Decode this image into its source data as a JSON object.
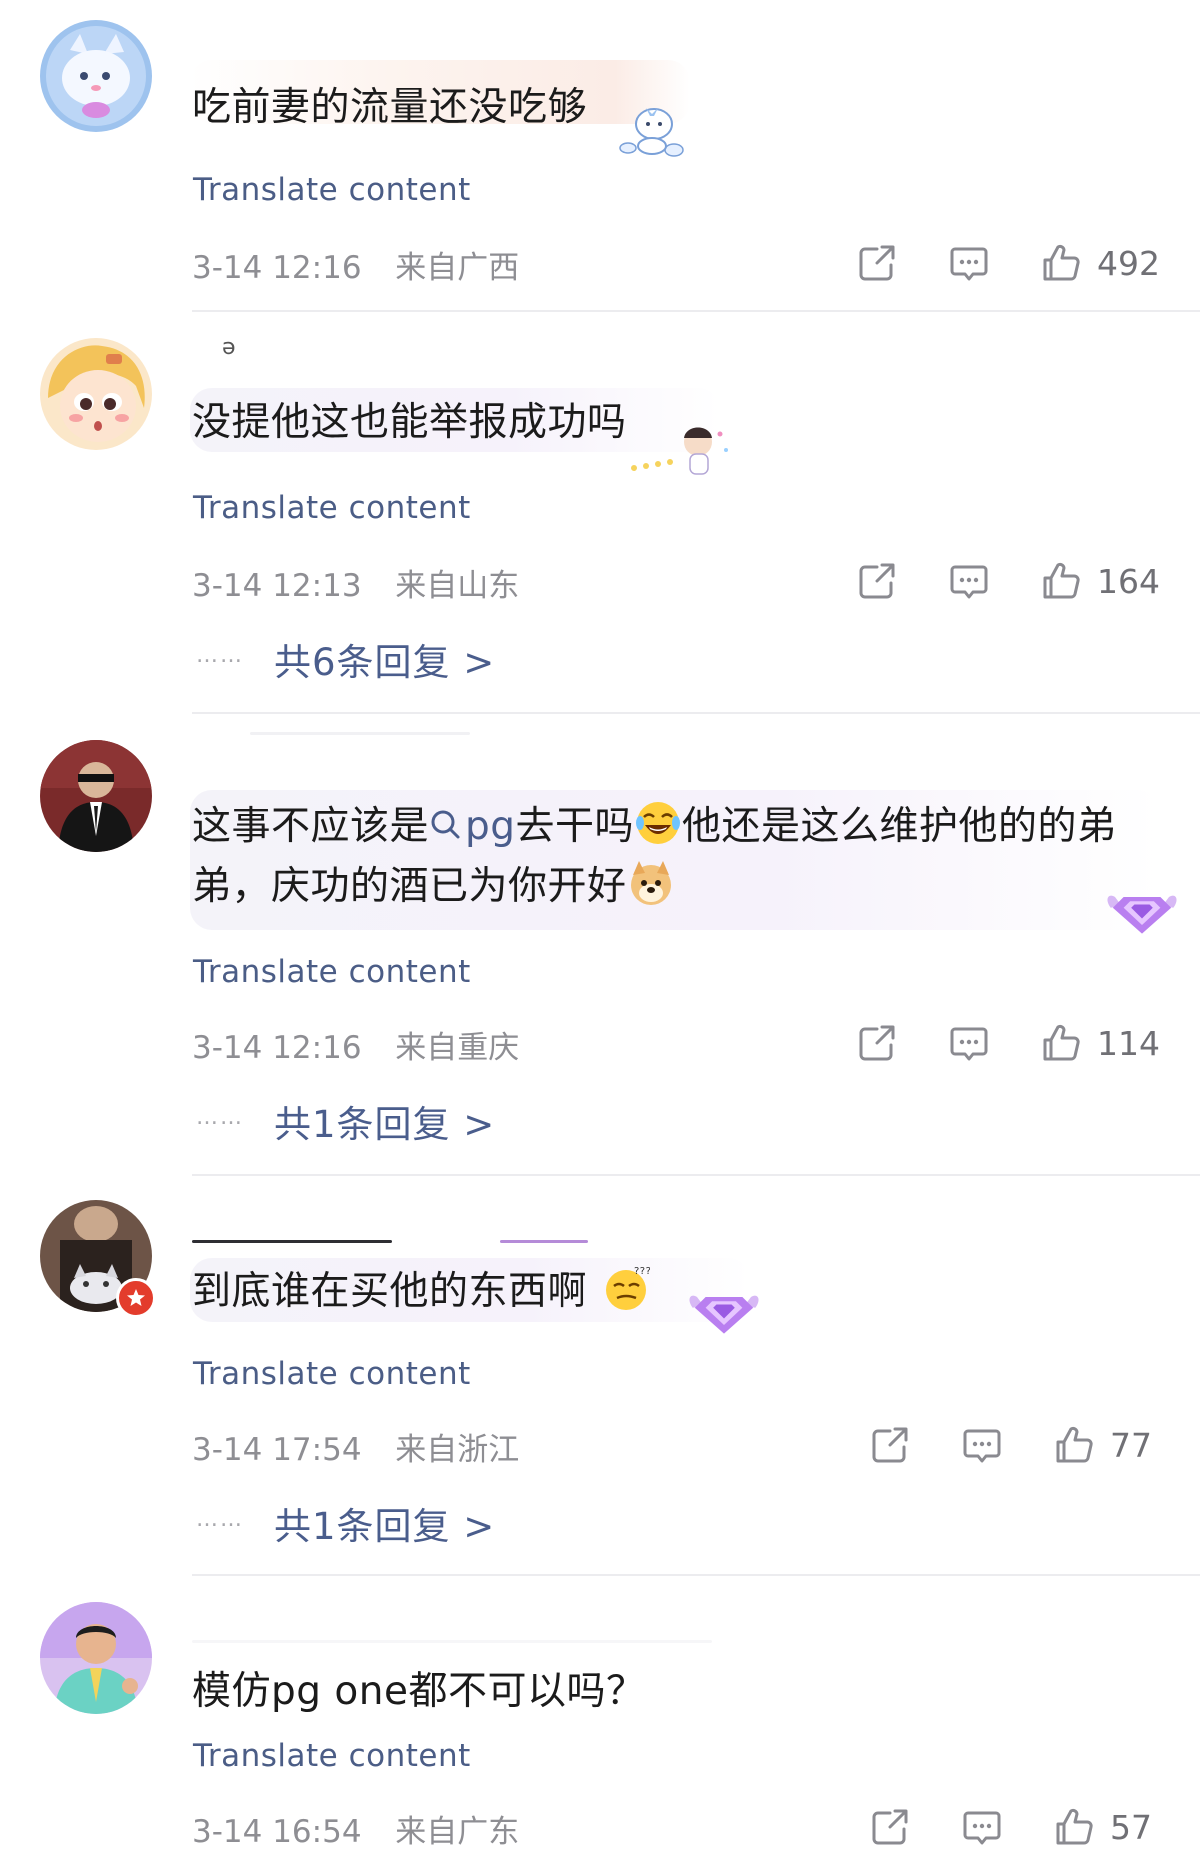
{
  "translate_label": "Translate content",
  "colors": {
    "accent_link": "#4a5d8c",
    "meta_gray": "#8e8e93",
    "divider": "#ececef",
    "badge_red": "#e33c2c"
  },
  "comments": [
    {
      "avatar_icon": "cartoon-bunny-avatar",
      "text": "吃前妻的流量还没吃够",
      "timestamp": "3-14 12:16",
      "location": "来自广西",
      "likes": "492",
      "replies_label": ""
    },
    {
      "avatar_icon": "cartoon-girl-avatar",
      "text": "没提他这也能举报成功吗",
      "timestamp": "3-14 12:13",
      "location": "来自山东",
      "likes": "164",
      "replies_label": "共6条回复 >"
    },
    {
      "avatar_icon": "man-in-suit-avatar",
      "text_part1": "这事不应该是",
      "search_term": "pg",
      "text_part2": "去干吗",
      "text_part3": "他还是这么维护他的的弟弟，庆功的酒已为你开好",
      "timestamp": "3-14 12:16",
      "location": "来自重庆",
      "likes": "114",
      "replies_label": "共1条回复 >"
    },
    {
      "avatar_icon": "pet-photo-avatar",
      "text": "到底谁在买他的东西啊",
      "timestamp": "3-14 17:54",
      "location": "来自浙江",
      "likes": "77",
      "replies_label": "共1条回复 >"
    },
    {
      "avatar_icon": "man-photo-avatar",
      "text": "模仿pg one都不可以吗？",
      "timestamp": "3-14 16:54",
      "location": "来自广东",
      "likes": "57",
      "replies_label": ""
    }
  ],
  "reply_dots": "……"
}
